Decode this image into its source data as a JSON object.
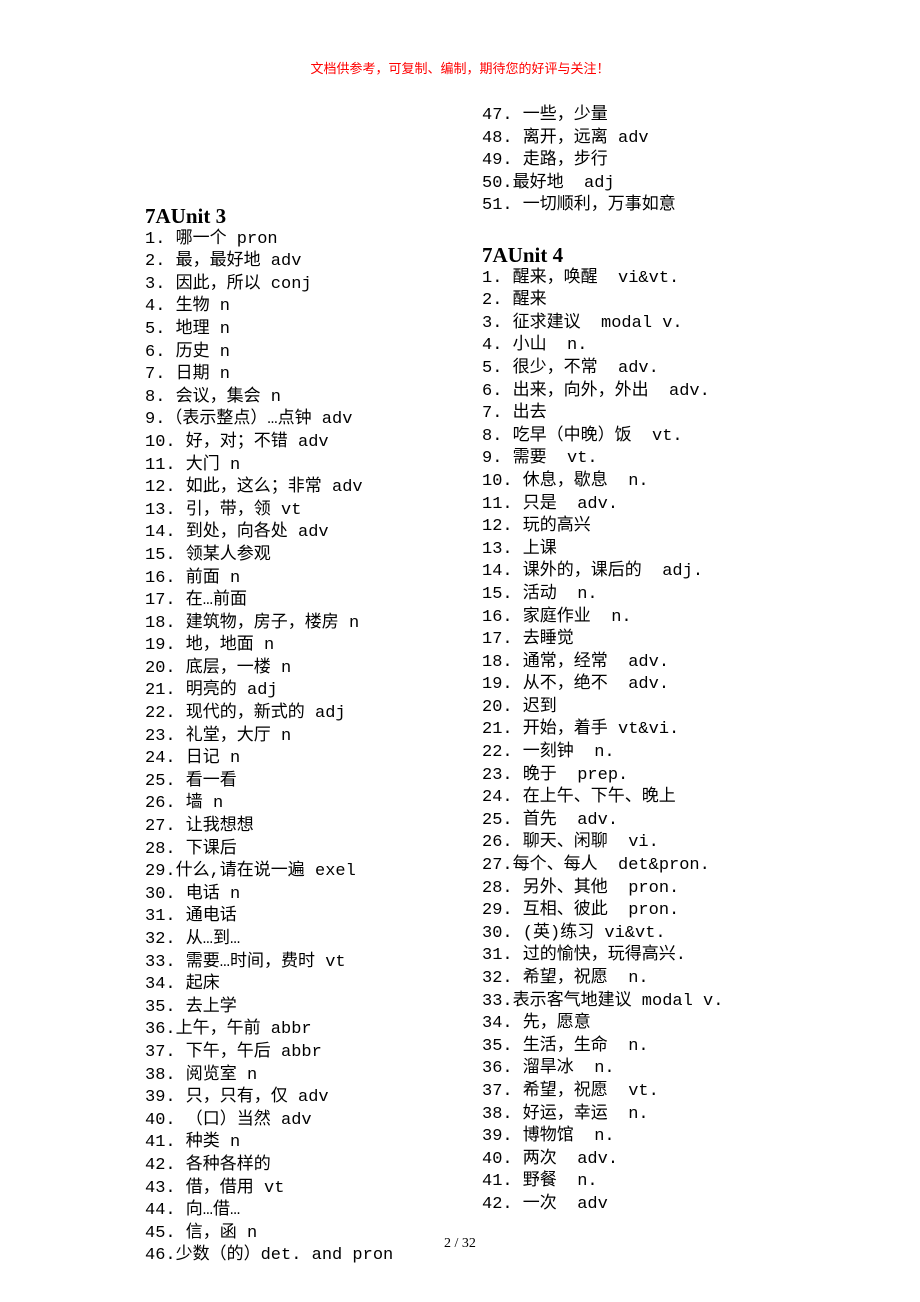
{
  "header": "文档供参考，可复制、编制，期待您的好评与关注！",
  "footer": "2 / 32",
  "col1_title": "7AUnit 3",
  "col1_items": [
    "1. 哪一个 pron",
    "2. 最，最好地 adv",
    "3. 因此，所以 conj",
    "4. 生物 n",
    "5. 地理 n",
    "6. 历史 n",
    "7. 日期 n",
    "8. 会议，集会 n",
    "9.（表示整点）…点钟 adv",
    "10. 好，对；不错 adv",
    "11. 大门 n",
    "12. 如此，这么；非常 adv",
    "13. 引，带，领 vt",
    "14. 到处，向各处 adv",
    "15. 领某人参观",
    "16. 前面 n",
    "17. 在…前面",
    "18. 建筑物，房子，楼房 n",
    "19. 地，地面 n",
    "20. 底层，一楼 n",
    "21. 明亮的 adj",
    "22. 现代的，新式的 adj",
    "23. 礼堂，大厅 n",
    "24. 日记 n",
    "25. 看一看",
    "26. 墙 n",
    "27. 让我想想",
    "28. 下课后",
    "29.什么,请在说一遍 exel",
    "30. 电话 n",
    "31. 通电话",
    "32. 从…到…",
    "33. 需要…时间，费时 vt",
    "34. 起床",
    "35. 去上学",
    "36.上午，午前 abbr",
    "37. 下午，午后 abbr",
    "38. 阅览室 n",
    "39. 只，只有，仅 adv",
    "40. （口）当然 adv",
    "41. 种类 n",
    "42. 各种各样的",
    "43. 借，借用 vt",
    "44. 向…借…",
    "45. 信，函 n",
    "46.少数（的）det. and pron"
  ],
  "col2a_items": [
    "47. 一些，少量",
    "48. 离开，远离 adv",
    "49. 走路，步行",
    "50.最好地  adj",
    "51. 一切顺利，万事如意"
  ],
  "col2_title": "7AUnit 4",
  "col2_items": [
    "1. 醒来，唤醒  vi&vt.",
    "2. 醒来",
    "3. 征求建议  modal v.",
    "4. 小山  n.",
    "5. 很少，不常  adv.",
    "6. 出来，向外，外出  adv.",
    "7. 出去",
    "8. 吃早（中晚）饭  vt.",
    "9. 需要  vt.",
    "10. 休息，歇息  n.",
    "11. 只是  adv.",
    "12. 玩的高兴",
    "13. 上课",
    "14. 课外的，课后的  adj.",
    "15. 活动  n.",
    "16. 家庭作业  n.",
    "17. 去睡觉",
    "18. 通常，经常  adv.",
    "19. 从不，绝不  adv.",
    "20. 迟到",
    "21. 开始，着手 vt&vi.",
    "22. 一刻钟  n.",
    "23. 晚于  prep.",
    "24. 在上午、下午、晚上",
    "25. 首先  adv.",
    "26. 聊天、闲聊  vi.",
    "27.每个、每人  det&pron.",
    "28. 另外、其他  pron.",
    "29. 互相、彼此  pron.",
    "30. (英)练习 vi&vt.",
    "31. 过的愉快，玩得高兴.",
    "32. 希望，祝愿  n.",
    "33.表示客气地建议 modal v.",
    "34. 先，愿意",
    "35. 生活，生命  n.",
    "36. 溜旱冰  n.",
    "37. 希望，祝愿  vt.",
    "38. 好运，幸运  n.",
    "39. 博物馆  n.",
    "40. 两次  adv.",
    "41. 野餐  n.",
    "42. 一次  adv"
  ]
}
